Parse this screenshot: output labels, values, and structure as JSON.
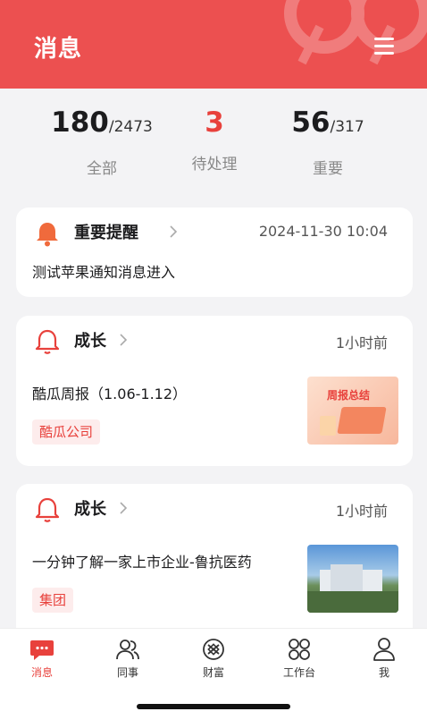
{
  "header": {
    "title": "消息"
  },
  "stats": [
    {
      "value": "180",
      "total": "/2473",
      "label": "全部"
    },
    {
      "value": "3",
      "total": "",
      "label": "待处理"
    },
    {
      "value": "56",
      "total": "/317",
      "label": "重要"
    }
  ],
  "cards": [
    {
      "category": "重要提醒",
      "time": "2024-11-30 10:04",
      "message": "测试苹果通知消息进入",
      "tag": ""
    },
    {
      "category": "成长",
      "time": "1小时前",
      "message": "酷瓜周报（1.06-1.12）",
      "tag": "酷瓜公司",
      "thumb_text": "周报总结"
    },
    {
      "category": "成长",
      "time": "1小时前",
      "message": "一分钟了解一家上市企业-鲁抗医药",
      "tag": "集团"
    }
  ],
  "tabbar": [
    {
      "label": "消息",
      "icon": "chat-bubble-icon",
      "active": true
    },
    {
      "label": "同事",
      "icon": "people-icon",
      "active": false
    },
    {
      "label": "财富",
      "icon": "wealth-icon",
      "active": false
    },
    {
      "label": "工作台",
      "icon": "workbench-icon",
      "active": false
    },
    {
      "label": "我",
      "icon": "person-icon",
      "active": false
    }
  ],
  "colors": {
    "accent": "#ec5050",
    "accent_text": "#e8413c",
    "background": "#f3f3f5"
  }
}
